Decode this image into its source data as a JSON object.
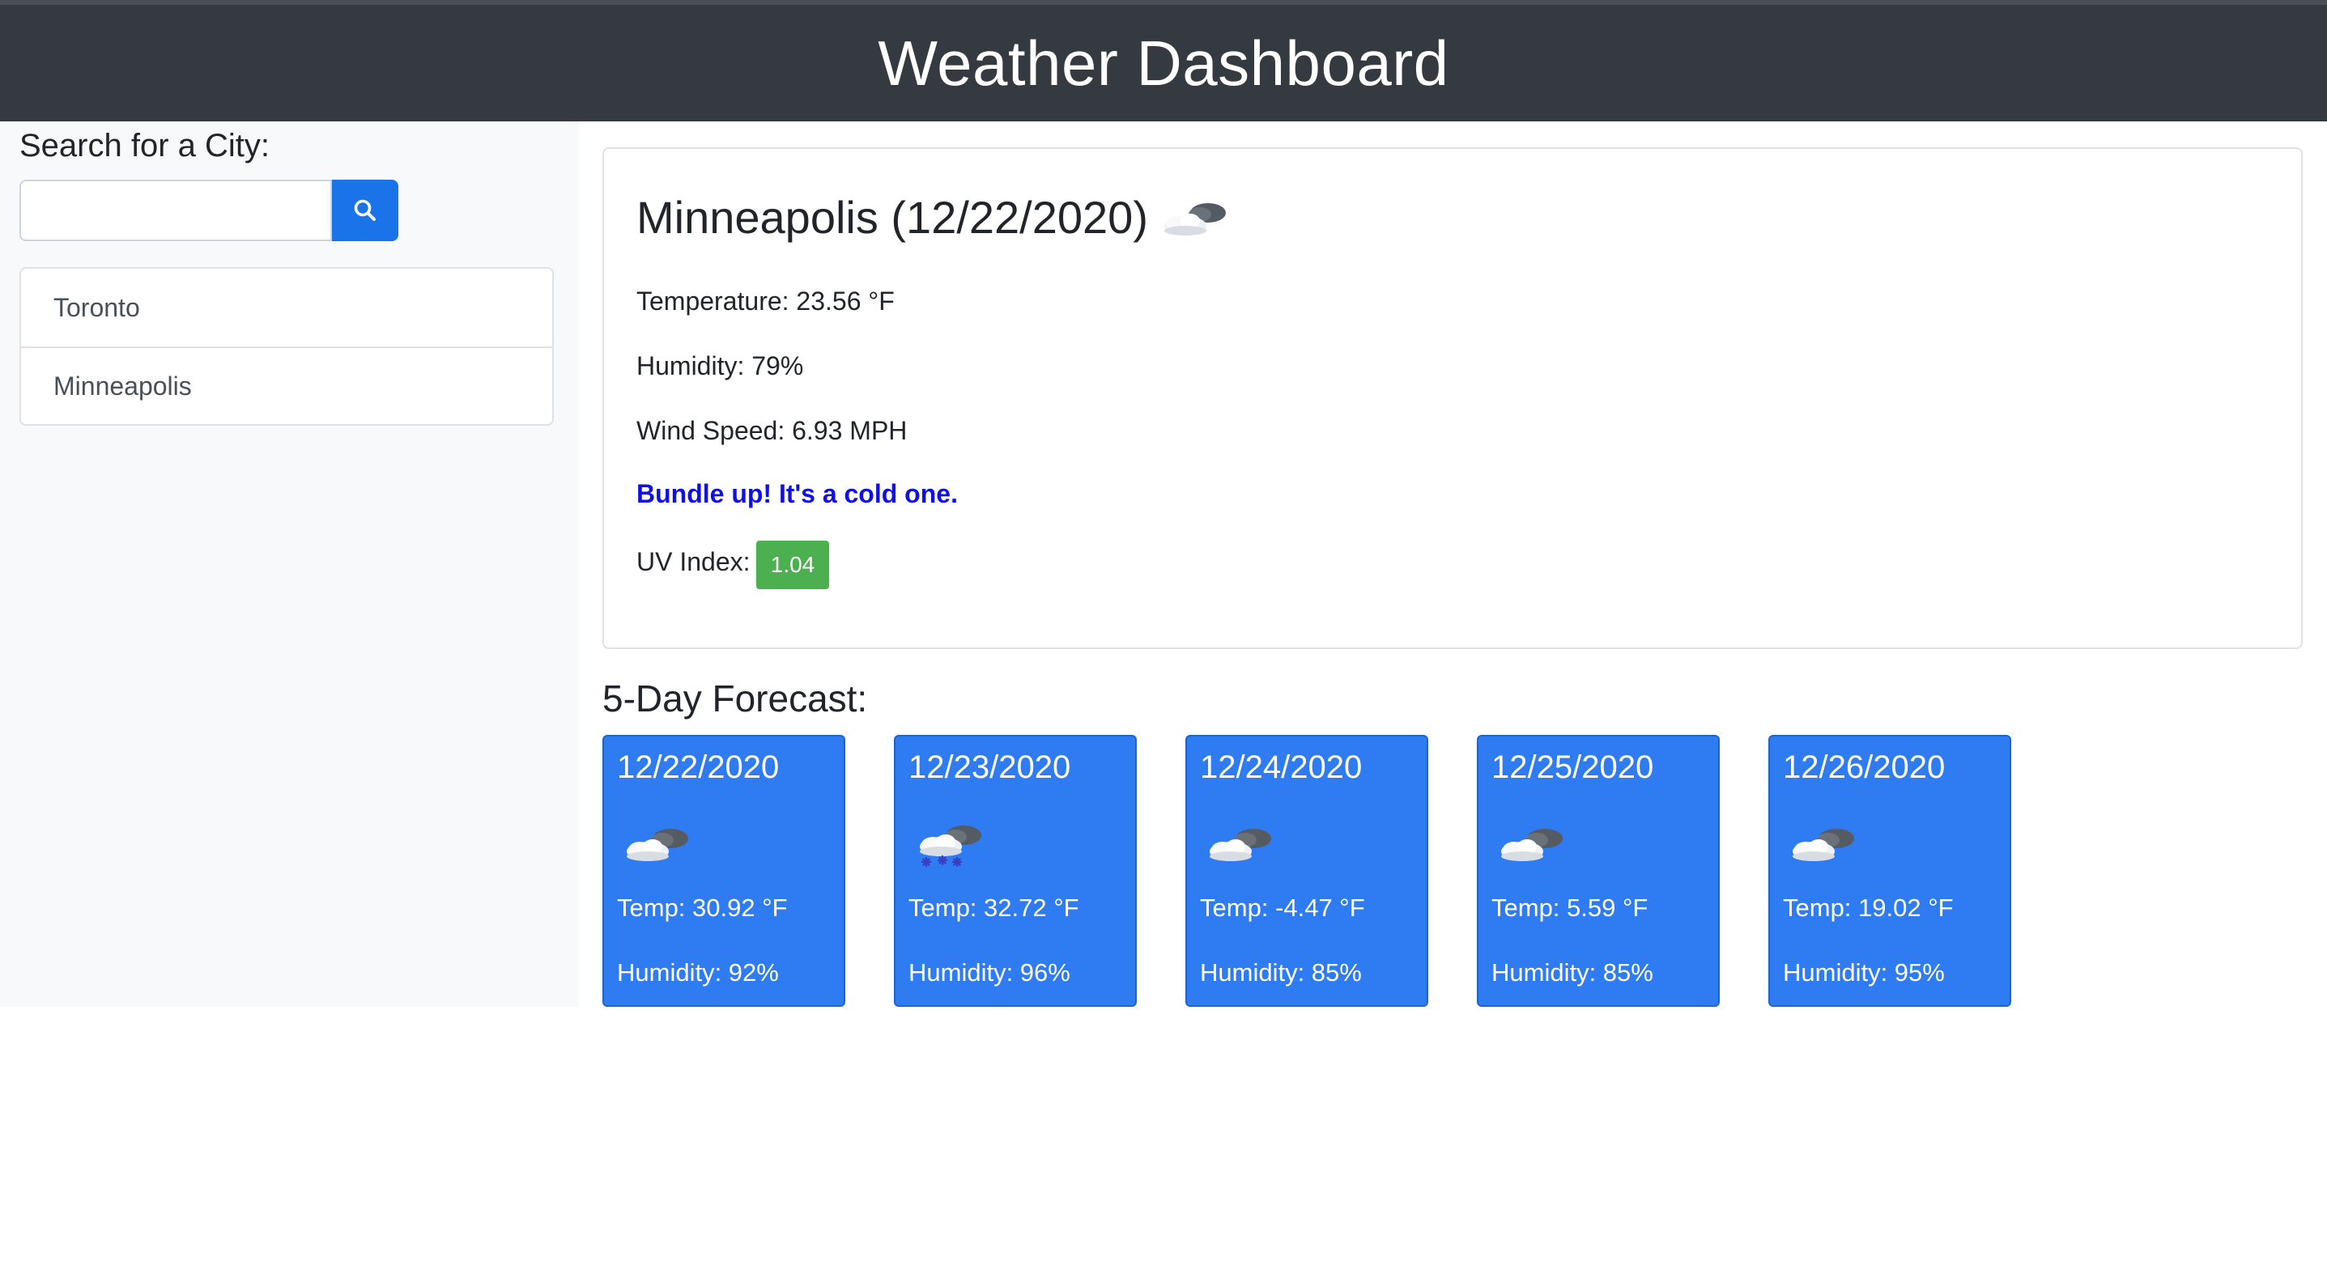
{
  "header": {
    "title": "Weather Dashboard"
  },
  "search": {
    "label": "Search for a City:",
    "value": "",
    "placeholder": "",
    "button_icon": "search-icon"
  },
  "history": [
    {
      "label": "Toronto"
    },
    {
      "label": "Minneapolis"
    }
  ],
  "current": {
    "title": "Minneapolis (12/22/2020)",
    "icon": "partly-cloudy-icon",
    "temperature": "Temperature: 23.56 °F",
    "humidity": "Humidity: 79%",
    "wind": "Wind Speed: 6.93 MPH",
    "advice": "Bundle up! It's a cold one.",
    "uv_label": "UV Index:",
    "uv_value": "1.04",
    "uv_color": "#4caf50"
  },
  "forecast": {
    "heading": "5-Day Forecast:",
    "days": [
      {
        "date": "12/22/2020",
        "icon": "partly-cloudy-icon",
        "temp": "Temp: 30.92 °F",
        "humidity": "Humidity: 92%"
      },
      {
        "date": "12/23/2020",
        "icon": "snow-cloud-icon",
        "temp": "Temp: 32.72 °F",
        "humidity": "Humidity: 96%"
      },
      {
        "date": "12/24/2020",
        "icon": "partly-cloudy-icon",
        "temp": "Temp: -4.47 °F",
        "humidity": "Humidity: 85%"
      },
      {
        "date": "12/25/2020",
        "icon": "partly-cloudy-icon",
        "temp": "Temp: 5.59 °F",
        "humidity": "Humidity: 85%"
      },
      {
        "date": "12/26/2020",
        "icon": "partly-cloudy-icon",
        "temp": "Temp: 19.02 °F",
        "humidity": "Humidity: 95%"
      }
    ]
  },
  "colors": {
    "header_bg": "#343a40",
    "accent": "#1a73e8",
    "forecast_card": "#2f7bf2",
    "advice_text": "#1010e6"
  }
}
